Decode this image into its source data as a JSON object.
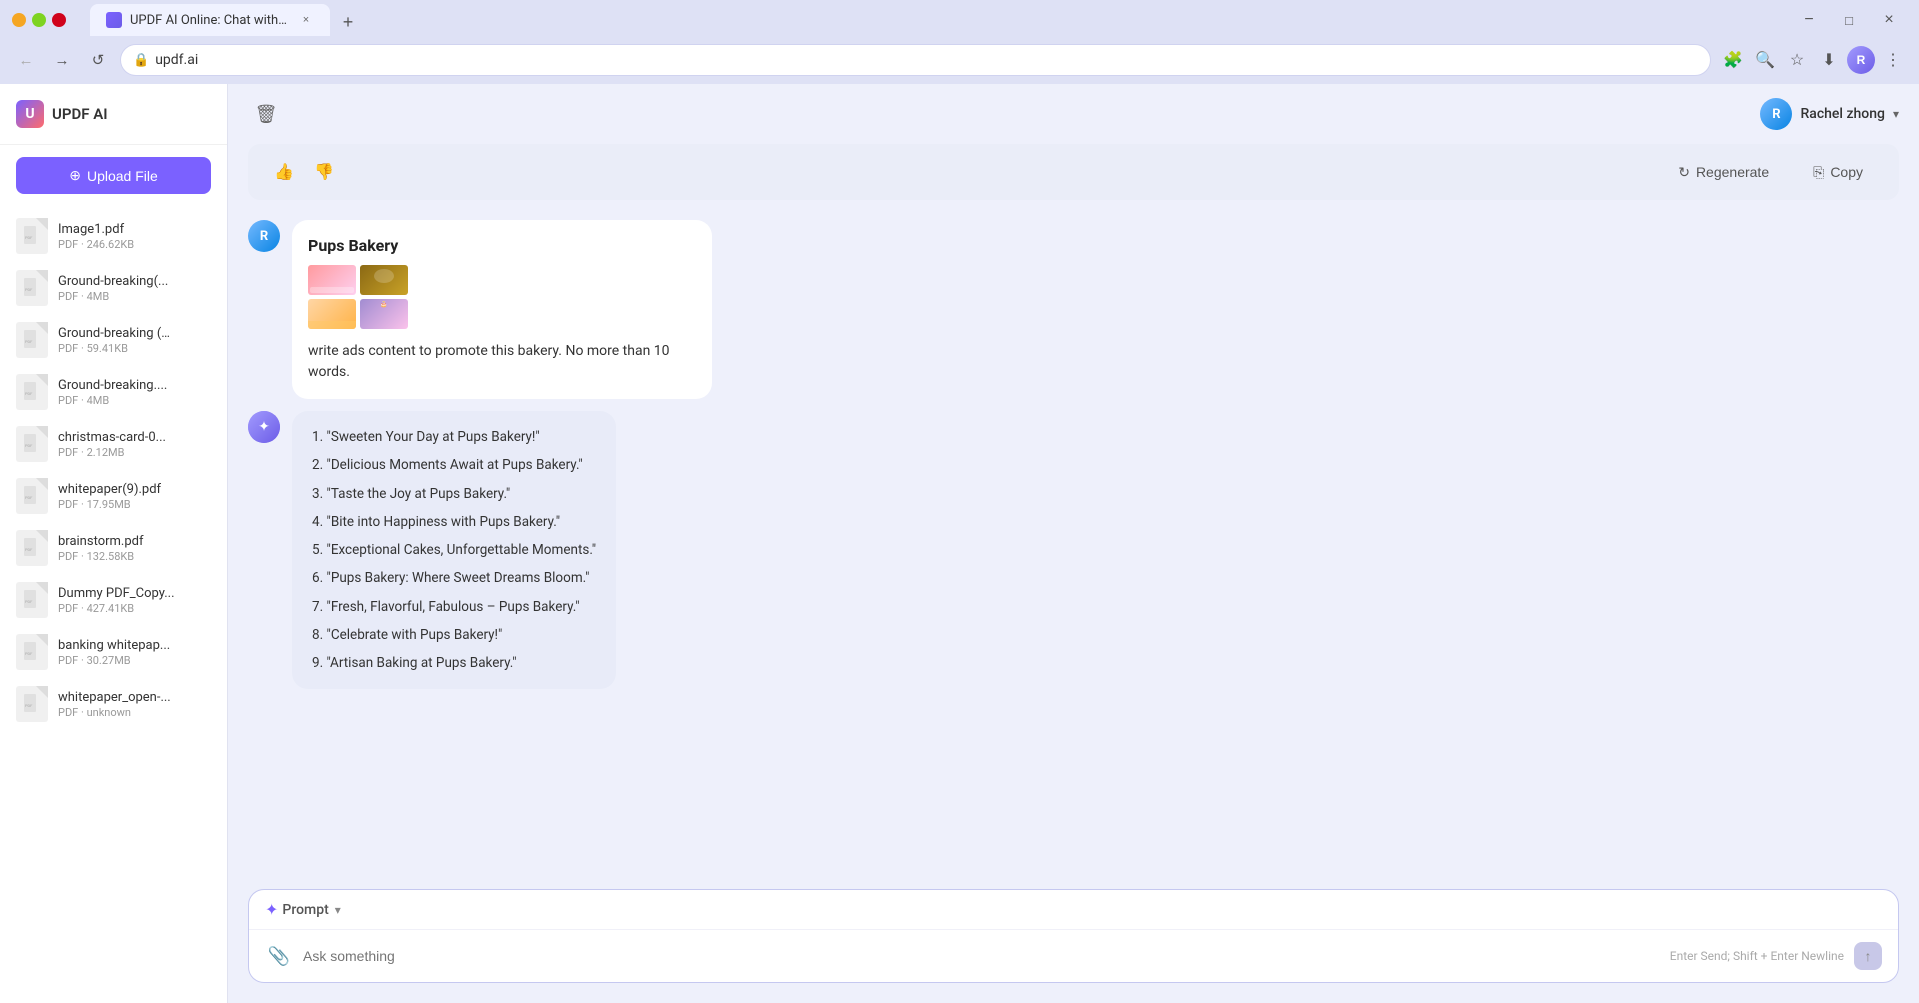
{
  "browser": {
    "tab_label": "UPDF AI Online: Chat with PDF",
    "address": "updf.ai",
    "new_tab_label": "+",
    "nav": {
      "back_icon": "←",
      "forward_icon": "→",
      "reload_icon": "↺",
      "home_icon": "⌂"
    },
    "window_controls": {
      "minimize": "−",
      "maximize": "□",
      "close": "×"
    }
  },
  "sidebar": {
    "logo_text": "U",
    "title": "UPDF AI",
    "upload_btn": "Upload File",
    "files": [
      {
        "name": "Image1.pdf",
        "size": "PDF · 246.62KB"
      },
      {
        "name": "Ground-breaking(...",
        "size": "PDF · 4MB"
      },
      {
        "name": "Ground-breaking (…",
        "size": "PDF · 59.41KB"
      },
      {
        "name": "Ground-breaking....",
        "size": "PDF · 4MB"
      },
      {
        "name": "christmas-card-0...",
        "size": "PDF · 2.12MB"
      },
      {
        "name": "whitepaper(9).pdf",
        "size": "PDF · 17.95MB"
      },
      {
        "name": "brainstorm.pdf",
        "size": "PDF · 132.58KB"
      },
      {
        "name": "Dummy PDF_Copy...",
        "size": "PDF · 427.41KB"
      },
      {
        "name": "banking whitepap...",
        "size": "PDF · 30.27MB"
      },
      {
        "name": "whitepaper_open-...",
        "size": "PDF · unknown"
      }
    ]
  },
  "topbar": {
    "trash_icon": "🗑",
    "user_name": "Rachel zhong",
    "user_avatar_letter": "R",
    "chevron": "▾"
  },
  "action_bar": {
    "thumbs_up": "👍",
    "thumbs_down": "👎",
    "regenerate_icon": "↻",
    "regenerate_label": "Regenerate",
    "copy_icon": "⎘",
    "copy_label": "Copy"
  },
  "user_message": {
    "avatar_letter": "R",
    "bakery_title": "Pups Bakery",
    "prompt_text": "write ads content to promote this bakery. No more than 10 words."
  },
  "ai_message": {
    "avatar_icon": "✦",
    "responses": [
      {
        "num": "1.",
        "text": "\"Sweeten Your Day at Pups Bakery!\""
      },
      {
        "num": "2.",
        "text": "\"Delicious Moments Await at Pups Bakery.\""
      },
      {
        "num": "3.",
        "text": "\"Taste the Joy at Pups Bakery.\""
      },
      {
        "num": "4.",
        "text": "\"Bite into Happiness with Pups Bakery.\""
      },
      {
        "num": "5.",
        "text": "\"Exceptional Cakes, Unforgettable Moments.\""
      },
      {
        "num": "6.",
        "text": "\"Pups Bakery: Where Sweet Dreams Bloom.\""
      },
      {
        "num": "7.",
        "text": "\"Fresh, Flavorful, Fabulous – Pups Bakery.\""
      },
      {
        "num": "8.",
        "text": "\"Celebrate with Pups Bakery!\""
      },
      {
        "num": "9.",
        "text": "\"Artisan Baking at Pups Bakery.\""
      }
    ]
  },
  "input_area": {
    "sparkle_icon": "✦",
    "prompt_label": "Prompt",
    "dropdown_icon": "▾",
    "attach_icon": "📎",
    "placeholder": "Ask something",
    "hint": "Enter Send; Shift + Enter Newline",
    "send_icon": "↑"
  }
}
